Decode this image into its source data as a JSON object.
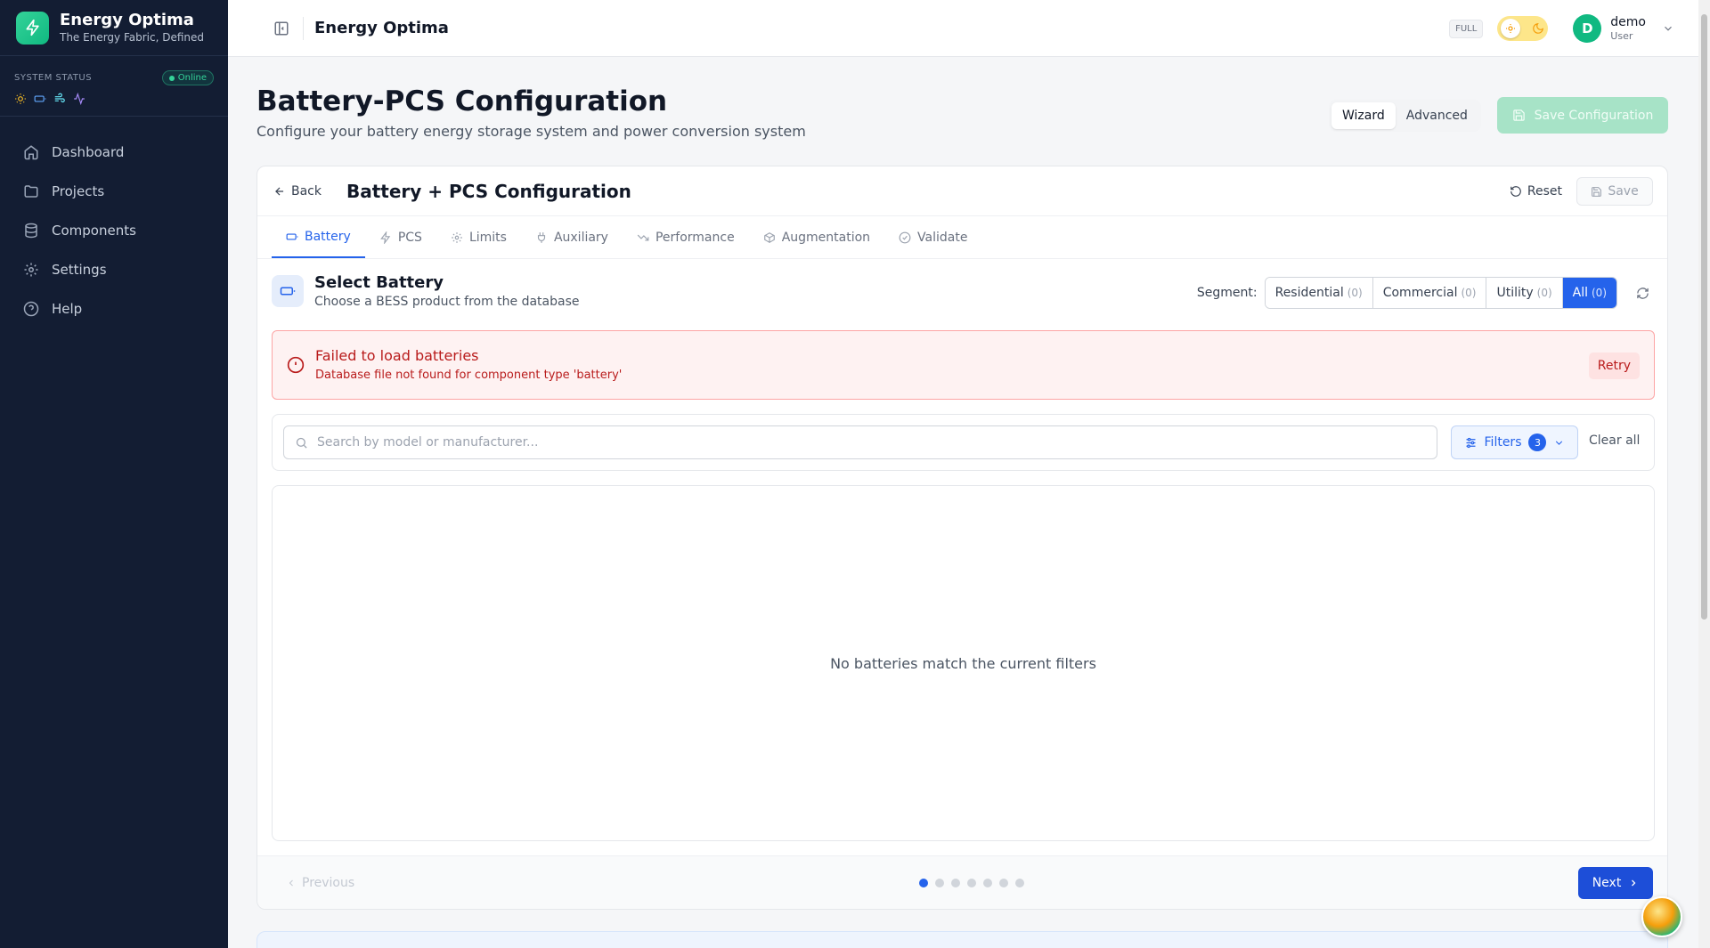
{
  "brand": {
    "name": "Energy Optima",
    "tagline": "The Energy Fabric, Defined"
  },
  "system_status": {
    "label": "SYSTEM STATUS",
    "status": "Online",
    "icons": [
      "sun-icon",
      "battery-icon",
      "wind-icon",
      "activity-icon"
    ]
  },
  "nav": {
    "items": [
      {
        "label": "Dashboard",
        "icon": "home-icon"
      },
      {
        "label": "Projects",
        "icon": "folder-icon"
      },
      {
        "label": "Components",
        "icon": "database-icon"
      },
      {
        "label": "Settings",
        "icon": "gear-icon"
      },
      {
        "label": "Help",
        "icon": "help-circle-icon"
      }
    ]
  },
  "topbar": {
    "title": "Energy Optima",
    "mode_badge": "FULL",
    "user": {
      "initial": "D",
      "name": "demo",
      "role": "User"
    }
  },
  "page": {
    "title": "Battery-PCS Configuration",
    "subtitle": "Configure your battery energy storage system and power conversion system",
    "modes": [
      "Wizard",
      "Advanced"
    ],
    "active_mode": "Wizard",
    "save_config_label": "Save Configuration"
  },
  "card": {
    "back_label": "Back",
    "title": "Battery + PCS Configuration",
    "reset_label": "Reset",
    "save_label": "Save",
    "tabs": [
      {
        "label": "Battery",
        "icon": "battery-icon",
        "active": true
      },
      {
        "label": "PCS",
        "icon": "zap-icon"
      },
      {
        "label": "Limits",
        "icon": "gear-icon"
      },
      {
        "label": "Auxiliary",
        "icon": "plug-icon"
      },
      {
        "label": "Performance",
        "icon": "trending-down-icon"
      },
      {
        "label": "Augmentation",
        "icon": "box-icon"
      },
      {
        "label": "Validate",
        "icon": "check-circle-icon"
      }
    ]
  },
  "select_battery": {
    "title": "Select Battery",
    "subtitle": "Choose a BESS product from the database",
    "segment_label": "Segment:",
    "segments": [
      {
        "label": "Residential",
        "count": "(0)"
      },
      {
        "label": "Commercial",
        "count": "(0)"
      },
      {
        "label": "Utility",
        "count": "(0)"
      },
      {
        "label": "All",
        "count": "(0)",
        "active": true
      }
    ]
  },
  "error": {
    "title": "Failed to load batteries",
    "message": "Database file not found for component type 'battery'",
    "retry_label": "Retry"
  },
  "search": {
    "placeholder": "Search by model or manufacturer...",
    "value": "",
    "filters_label": "Filters",
    "filter_count": "3",
    "clear_label": "Clear all"
  },
  "results": {
    "empty_message": "No batteries match the current filters"
  },
  "footer": {
    "previous_label": "Previous",
    "next_label": "Next",
    "total_steps": 7,
    "current_step": 1
  },
  "colors": {
    "sidebar_bg": "#131d33",
    "primary": "#2563eb",
    "brand_green": "#10b981",
    "error": "#b91c1c"
  }
}
